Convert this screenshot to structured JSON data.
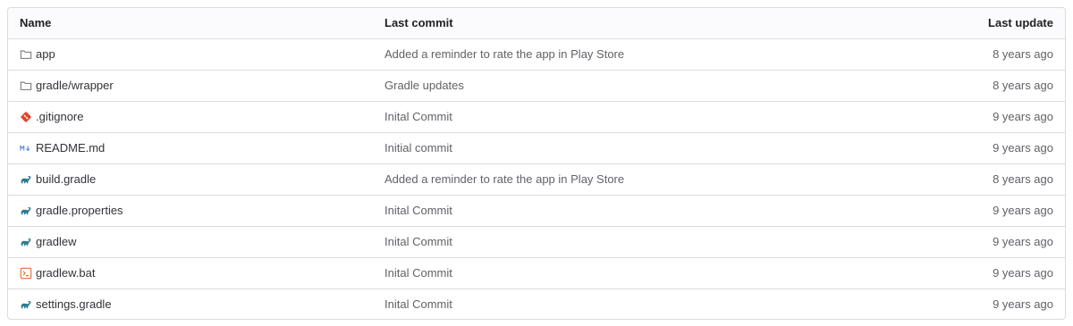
{
  "headers": {
    "name": "Name",
    "last_commit": "Last commit",
    "last_update": "Last update"
  },
  "colors": {
    "border": "#dcdcde",
    "header_bg": "#fbfafd",
    "folder_icon": "#737278",
    "git_icon": "#e24329",
    "markdown_icon": "#5b8fd8",
    "gradle_icon": "#2d7a8f",
    "bat_icon": "#e0703a"
  },
  "rows": [
    {
      "name": "app",
      "icon": "folder-icon",
      "commit": "Added a reminder to rate the app in Play Store",
      "updated": "8 years ago"
    },
    {
      "name": "gradle/wrapper",
      "icon": "folder-icon",
      "commit": "Gradle updates",
      "updated": "8 years ago"
    },
    {
      "name": ".gitignore",
      "icon": "git-icon",
      "commit": "Inital Commit",
      "updated": "9 years ago"
    },
    {
      "name": "README.md",
      "icon": "markdown-icon",
      "commit": "Initial commit",
      "updated": "9 years ago"
    },
    {
      "name": "build.gradle",
      "icon": "gradle-icon",
      "commit": "Added a reminder to rate the app in Play Store",
      "updated": "8 years ago"
    },
    {
      "name": "gradle.properties",
      "icon": "gradle-icon",
      "commit": "Inital Commit",
      "updated": "9 years ago"
    },
    {
      "name": "gradlew",
      "icon": "gradle-icon",
      "commit": "Inital Commit",
      "updated": "9 years ago"
    },
    {
      "name": "gradlew.bat",
      "icon": "terminal-file-icon",
      "commit": "Inital Commit",
      "updated": "9 years ago"
    },
    {
      "name": "settings.gradle",
      "icon": "gradle-icon",
      "commit": "Inital Commit",
      "updated": "9 years ago"
    }
  ]
}
